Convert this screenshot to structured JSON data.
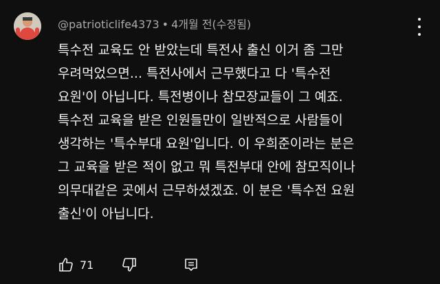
{
  "comment": {
    "author": "@patrioticlife4373",
    "separator": "•",
    "time": "4개월 전(수정됨)",
    "lines": [
      "특수전 교육도 안 받았는데 특전사 출신 이거 좀 그만",
      "우려먹었으면... 특전사에서 근무했다고 다 '특수전",
      "요원'이 아닙니다. 특전병이나 참모장교들이 그 예죠.",
      "특수전 교육을 받은 인원들만이 일반적으로 사람들이",
      "생각하는 '특수부대 요원'입니다. 이 우희준이라는 분은",
      "그 교육을 받은 적이 없고 뭐 특전부대 안에 참모직이나",
      "의무대같은 곳에서 근무하셨겠죠. 이 분은 '특수전 요원",
      "출신'이 아닙니다."
    ],
    "likes": "71",
    "icons": {
      "avatar": "avatar",
      "more": "more-vert-icon",
      "like": "thumbs-up-icon",
      "dislike": "thumbs-down-icon",
      "reply": "reply-comment-icon"
    }
  },
  "colors": {
    "background": "#0f0f0f",
    "text": "#f1f1f1",
    "meta": "#aaaaaa"
  }
}
